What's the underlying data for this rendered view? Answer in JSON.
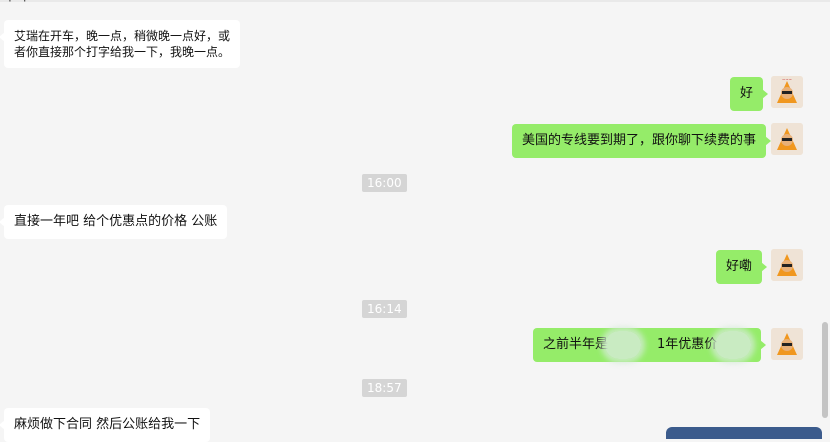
{
  "messages": [
    {
      "side": "in",
      "text": "艾瑞在开车，晚一点，稍微晚一点好，或者你直接那个打字给我一下，我晚一点。"
    },
    {
      "side": "out",
      "text": "好"
    },
    {
      "side": "out",
      "text": "美国的专线要到期了，跟你聊下续费的事"
    },
    {
      "side": "in",
      "text": "直接一年吧 给个优惠点的价格 公账"
    },
    {
      "side": "out",
      "text": "好嘞"
    },
    {
      "side": "out",
      "text_a": "之前半年是",
      "text_b": "1年优惠价"
    },
    {
      "side": "in",
      "text": "麻烦做下合同 然后公账给我一下"
    }
  ],
  "times": [
    "16:00",
    "16:14",
    "18:57"
  ],
  "colors": {
    "outgoing": "#95ec69",
    "incoming": "#ffffff",
    "background": "#f5f5f5"
  },
  "icons": {
    "avatar": "orange-hooded-avatar-icon"
  }
}
